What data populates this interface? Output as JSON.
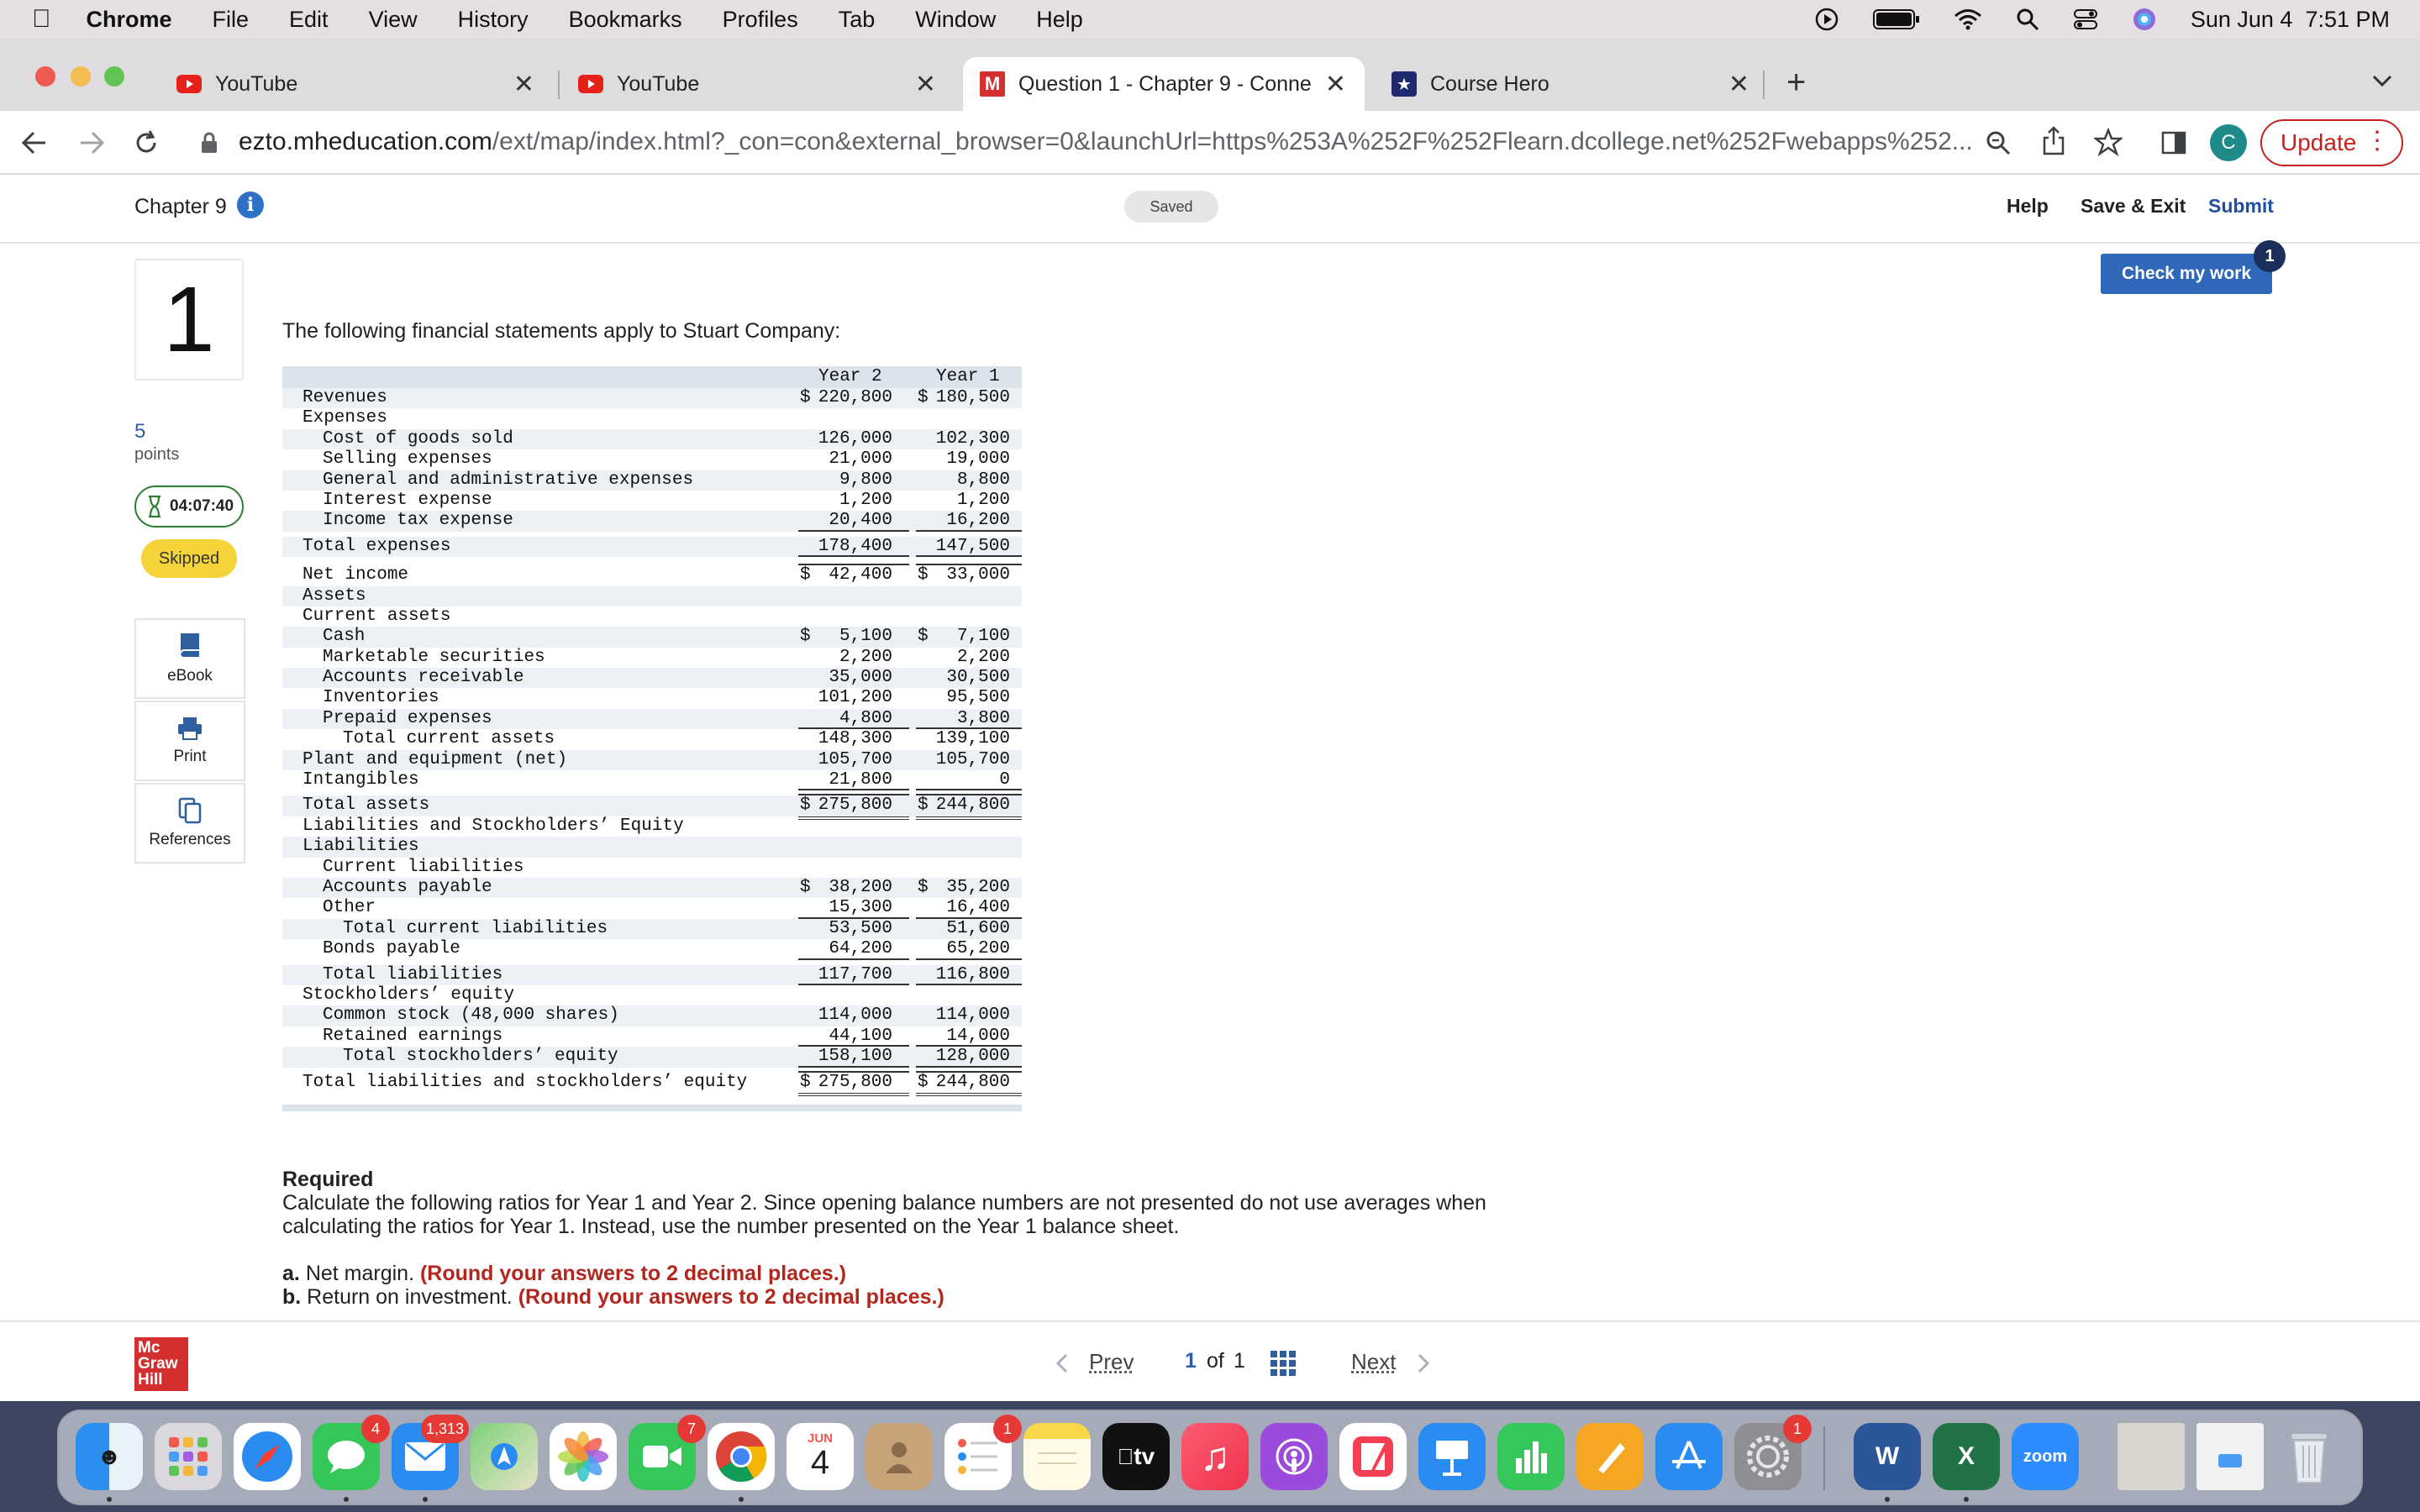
{
  "menubar": {
    "items": [
      "Chrome",
      "File",
      "Edit",
      "View",
      "History",
      "Bookmarks",
      "Profiles",
      "Tab",
      "Window",
      "Help"
    ],
    "clock": "Sun Jun 4  7:51 PM"
  },
  "browser": {
    "tabs": [
      {
        "title": "YouTube"
      },
      {
        "title": "YouTube"
      },
      {
        "title": "Question 1 - Chapter 9 - Conne"
      },
      {
        "title": "Course Hero"
      }
    ],
    "url_host": "ezto.mheducation.com",
    "url_path": "/ext/map/index.html?_con=con&external_browser=0&launchUrl=https%253A%252F%252Flearn.dcollege.net%252Fwebapps%252...",
    "profile_initial": "C",
    "update_label": "Update"
  },
  "header": {
    "chapter": "Chapter 9",
    "saved": "Saved",
    "help": "Help",
    "save_exit": "Save & Exit",
    "submit": "Submit"
  },
  "check": {
    "label": "Check my work",
    "badge": "1"
  },
  "rail": {
    "qnum": "1",
    "points_value": "5",
    "points_label": "points",
    "timer": "04:07:40",
    "status": "Skipped",
    "tools": [
      "eBook",
      "Print",
      "References"
    ]
  },
  "question": {
    "intro": "The following financial statements apply to Stuart Company:",
    "required_title": "Required",
    "required_text": "Calculate the following ratios for Year 1 and Year 2. Since opening balance numbers are not presented do not use averages when calculating the ratios for Year 1. Instead, use the number presented on the Year 1 balance sheet.",
    "parts": [
      {
        "letter": "a.",
        "text": "Net margin.",
        "note": "(Round your answers to 2 decimal places.)"
      },
      {
        "letter": "b.",
        "text": "Return on investment.",
        "note": "(Round your answers to 2 decimal places.)"
      }
    ]
  },
  "table": {
    "col_year2": "Year 2",
    "col_year1": "Year 1",
    "rows": [
      {
        "label": "Revenues",
        "y2": "220,800",
        "y1": "180,500",
        "dollar": true
      },
      {
        "label": "Expenses"
      },
      {
        "label": "Cost of goods sold",
        "y2": "126,000",
        "y1": "102,300"
      },
      {
        "label": "Selling expenses",
        "y2": "21,000",
        "y1": "19,000"
      },
      {
        "label": "General and administrative expenses",
        "y2": "9,800",
        "y1": "8,800"
      },
      {
        "label": "Interest expense",
        "y2": "1,200",
        "y1": "1,200"
      },
      {
        "label": "Income tax expense",
        "y2": "20,400",
        "y1": "16,200"
      },
      {
        "label": "Total expenses",
        "y2": "178,400",
        "y1": "147,500"
      },
      {
        "label": "Net income",
        "y2": "42,400",
        "y1": "33,000",
        "dollar": true
      },
      {
        "label": "Assets"
      },
      {
        "label": "Current assets"
      },
      {
        "label": "Cash",
        "y2": "5,100",
        "y1": "7,100",
        "dollar": true
      },
      {
        "label": "Marketable securities",
        "y2": "2,200",
        "y1": "2,200"
      },
      {
        "label": "Accounts receivable",
        "y2": "35,000",
        "y1": "30,500"
      },
      {
        "label": "Inventories",
        "y2": "101,200",
        "y1": "95,500"
      },
      {
        "label": "Prepaid expenses",
        "y2": "4,800",
        "y1": "3,800"
      },
      {
        "label": "Total current assets",
        "y2": "148,300",
        "y1": "139,100"
      },
      {
        "label": "Plant and equipment (net)",
        "y2": "105,700",
        "y1": "105,700"
      },
      {
        "label": "Intangibles",
        "y2": "21,800",
        "y1": "0"
      },
      {
        "label": "Total assets",
        "y2": "275,800",
        "y1": "244,800",
        "dollar": true
      },
      {
        "label": "Liabilities and Stockholders’ Equity"
      },
      {
        "label": "Liabilities"
      },
      {
        "label": "Current liabilities"
      },
      {
        "label": "Accounts payable",
        "y2": "38,200",
        "y1": "35,200",
        "dollar": true
      },
      {
        "label": "Other",
        "y2": "15,300",
        "y1": "16,400"
      },
      {
        "label": "Total current liabilities",
        "y2": "53,500",
        "y1": "51,600"
      },
      {
        "label": "Bonds payable",
        "y2": "64,200",
        "y1": "65,200"
      },
      {
        "label": "Total liabilities",
        "y2": "117,700",
        "y1": "116,800"
      },
      {
        "label": "Stockholders’ equity"
      },
      {
        "label": "Common stock (48,000 shares)",
        "y2": "114,000",
        "y1": "114,000"
      },
      {
        "label": "Retained earnings",
        "y2": "44,100",
        "y1": "14,000"
      },
      {
        "label": "Total stockholders’ equity",
        "y2": "158,100",
        "y1": "128,000"
      },
      {
        "label": "Total liabilities and stockholders’ equity",
        "y2": "275,800",
        "y1": "244,800",
        "dollar": true
      }
    ]
  },
  "footer": {
    "logo": [
      "Mc",
      "Graw",
      "Hill"
    ],
    "prev": "Prev",
    "page_current": "1",
    "page_of": "of",
    "page_total": "1",
    "next": "Next"
  },
  "dock": {
    "badge_messages": "4",
    "badge_mail": "1,313",
    "badge_facetime": "7",
    "badge_reminders": "1",
    "badge_settings": "1",
    "cal_month": "JUN",
    "cal_day": "4",
    "tv_label": "tv",
    "zoom_label": "zoom",
    "word_letter": "W",
    "excel_letter": "X"
  },
  "colors": {
    "accent_blue": "#2f5f9e",
    "red_note": "#b3261e",
    "skipped": "#f5d33b",
    "update_red": "#c5221f"
  }
}
